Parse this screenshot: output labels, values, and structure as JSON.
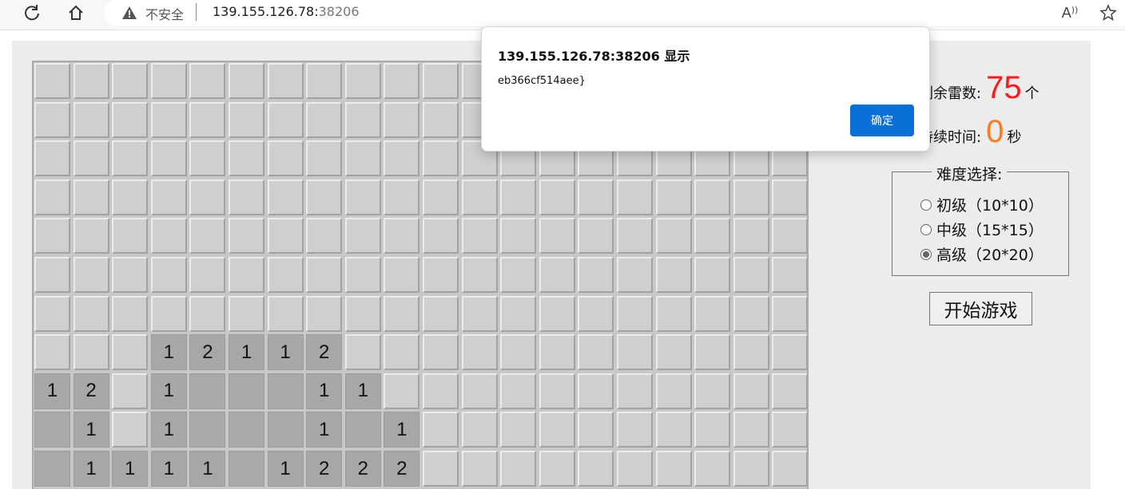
{
  "browser": {
    "insecure_label": "不安全",
    "url_host": "139.155.126.78:",
    "url_port": "38206",
    "reload_icon": "reload-icon",
    "home_icon": "home-icon",
    "read_aloud_icon": "read-aloud-icon",
    "favorite_icon": "star-icon"
  },
  "stats": {
    "mines_label": "剩余雷数:",
    "mines_value": "75",
    "mines_unit": "个",
    "time_label": "持续时间:",
    "time_value": "0",
    "time_unit": "秒"
  },
  "difficulty": {
    "legend": "难度选择:",
    "options": [
      {
        "label": "初级（10*10）",
        "selected": false
      },
      {
        "label": "中级（15*15）",
        "selected": false
      },
      {
        "label": "高级（20*20）",
        "selected": true
      }
    ]
  },
  "start_button": "开始游戏",
  "dialog": {
    "title": "139.155.126.78:38206 显示",
    "message": "eb366cf514aee}",
    "ok_label": "确定"
  },
  "board": {
    "visible_rows": [
      "....................",
      "....................",
      "....................",
      "....................",
      "....................",
      "....................",
      "....................",
      "...12112............",
      "12.1___11...........",
      "_1.1___1_1..........",
      "_1111_1222.........."
    ]
  }
}
